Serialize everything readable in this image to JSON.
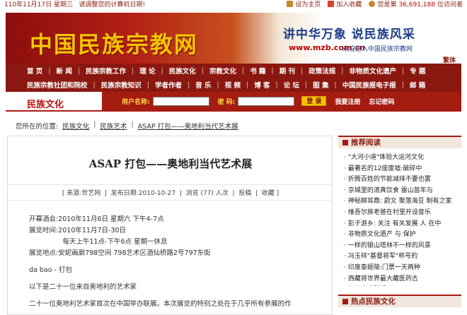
{
  "topbar": {
    "date_text": "110年11月17日 星期三",
    "notice": "请调整您的计算机日期!",
    "homepage": "设为主页",
    "favorite": "加入收藏",
    "visitor_prefix": "您是第",
    "visitor_count": "36,691,188",
    "visitor_suffix": "位访问者"
  },
  "header": {
    "logo": "中国民族宗教网",
    "slogan": "讲中华万象 说民族风采",
    "url": "www.mzb.com.cn",
    "welcome": "欢迎进入中国民族宗教网",
    "traditional": "繁体"
  },
  "nav": {
    "row1": [
      "首 页",
      "新 闻",
      "民族宗教工作",
      "理 论",
      "民族文化",
      "宗教文化",
      "书 籍",
      "期 刊",
      "政策法规",
      "非物质文化遗产",
      "专 题"
    ],
    "row2": [
      "民族宗教社团和院校",
      "民族宗教知识",
      "学者作者",
      "音 乐",
      "视 频",
      "博 客",
      "论 坛",
      "图 集",
      "中国民族报电子报",
      "邮 箱"
    ]
  },
  "login": {
    "section_title": "民族文化",
    "user_label": "用户名称:",
    "pass_label": "密  码:",
    "login_button": "登 录",
    "register": "我要注册",
    "forgot": "忘记密码"
  },
  "breadcrumb": {
    "prefix": "您所在的位置:",
    "items": [
      "民族文化",
      "民族艺术",
      "ASAP 打包——奥地利当代艺术展"
    ]
  },
  "article": {
    "title": "ASAP 打包——奥地利当代艺术展",
    "source": "[ 来源:世艺网",
    "published": "发布日期:2010-10-27",
    "views_label": "浏览 (",
    "views_count": "77",
    "views_suffix": ") 人次",
    "print": "投稿",
    "favorite": "收藏 ]",
    "lines": [
      "开幕酒会:2010年11月6日  星期六  下午4-7点",
      "展览时间:2010年11月7日-30日",
      "　　　　　每天上午11点-下午6点  星期一休息",
      "展览地点:安妮画廊798空间   798艺术区酒仙桥路2号797东街",
      "da bao - 打包",
      "以下是二十一位来自奥地利的艺术家",
      "二十一位奥地利艺术家首次在中国举办联展。本次展览的特别之处在于几乎所有参展的作"
    ]
  },
  "sidebar": {
    "recommended_title": "推荐阅读",
    "recommended": [
      "\"大河小道\"体验大运河文化",
      "最著名的12座废墟:破碎中",
      "折腾百姓的节能减排不要也罢",
      "京城里的清真饮食    雷山苗年与",
      "神秘脚耳鼎:  蔚文  聚落海豆  制有之家",
      "维吾尔族老爸在村里开设音乐",
      "彭子游乡:  关注  有关发展  人  在中",
      "非物质文化遗产  与  保护",
      "一样的银山塔林不一样的风景",
      "冯玉祥\"基督将军\"称号的",
      "印度泰姬陵:门票一天两种",
      "西藏将世界最大藏医药古",
      "老子之道别解"
    ],
    "hot_title": "热点民族文化"
  }
}
